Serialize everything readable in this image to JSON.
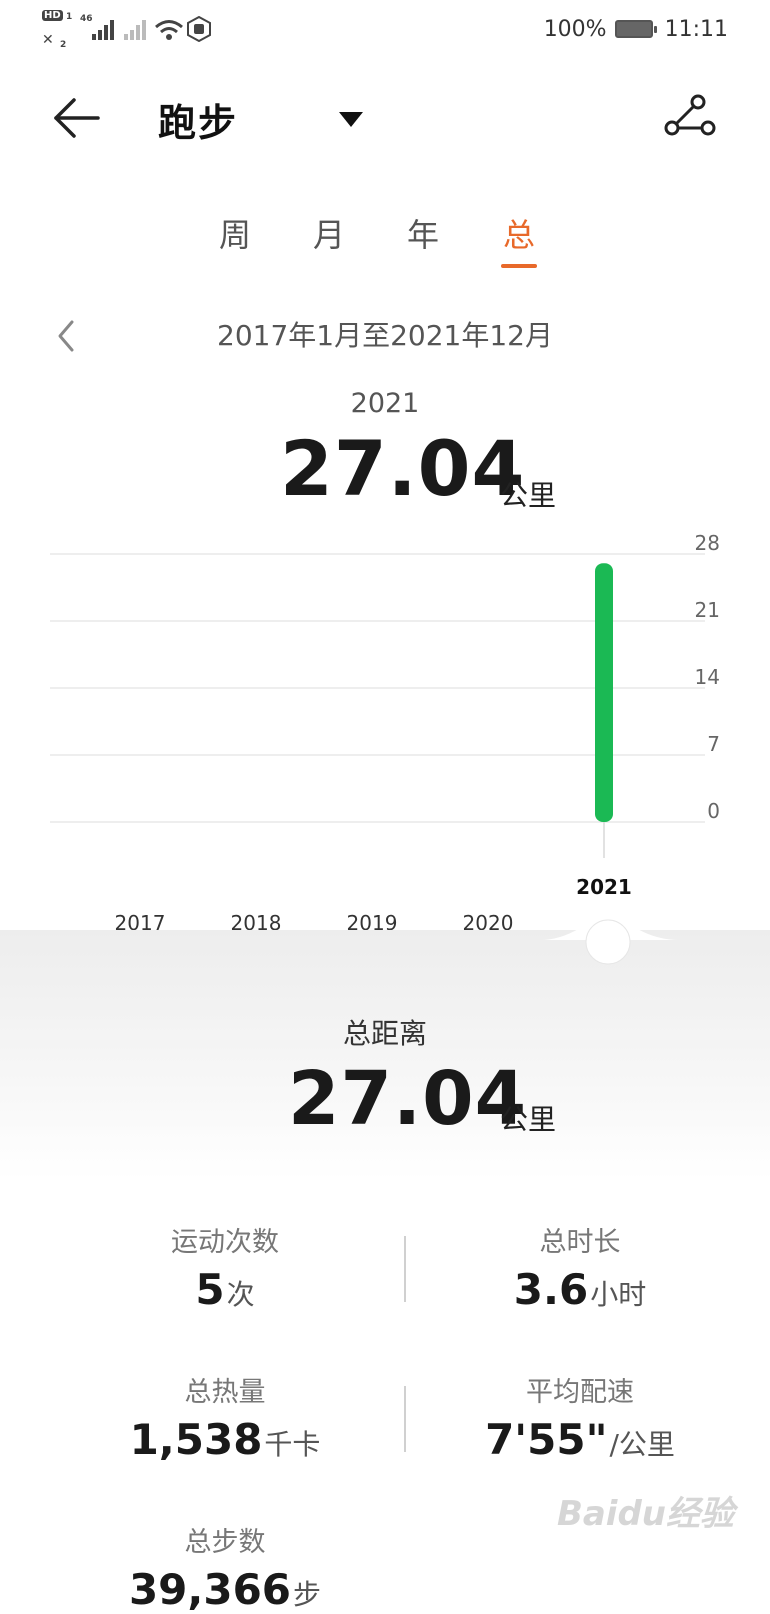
{
  "status_bar": {
    "hd_label": "HD",
    "network_label": "46",
    "sim1": "1",
    "sim2": "2",
    "battery": "100%",
    "time": "11:11"
  },
  "header": {
    "title": "跑步"
  },
  "tabs": [
    {
      "label": "周",
      "active": false
    },
    {
      "label": "月",
      "active": false
    },
    {
      "label": "年",
      "active": false
    },
    {
      "label": "总",
      "active": true
    }
  ],
  "range": {
    "text": "2017年1月至2021年12月"
  },
  "selected": {
    "year": "2021",
    "value": "27.04",
    "unit": "公里"
  },
  "chart_data": {
    "type": "bar",
    "categories": [
      "2017",
      "2018",
      "2019",
      "2020",
      "2021"
    ],
    "values": [
      0,
      0,
      0,
      0,
      27.04
    ],
    "yticks": [
      "0",
      "7",
      "14",
      "21",
      "28"
    ],
    "ylim": [
      0,
      28
    ],
    "selected_category": "2021",
    "bar_color": "#1bb954",
    "grid": true,
    "title": "",
    "xlabel": "",
    "ylabel": ""
  },
  "summary": {
    "total_label": "总距离",
    "total_value": "27.04",
    "total_unit": "公里",
    "stats": [
      {
        "label": "运动次数",
        "value": "5",
        "unit": "次"
      },
      {
        "label": "总时长",
        "value": "3.6",
        "unit": "小时"
      },
      {
        "label": "总热量",
        "value": "1,538",
        "unit": "千卡"
      },
      {
        "label": "平均配速",
        "value": "7'55\"",
        "unit": "/公里"
      },
      {
        "label": "总步数",
        "value": "39,366",
        "unit": "步"
      }
    ]
  },
  "watermark": "Baidu经验",
  "colors": {
    "accent": "#e8692a",
    "bar": "#1bb954"
  }
}
